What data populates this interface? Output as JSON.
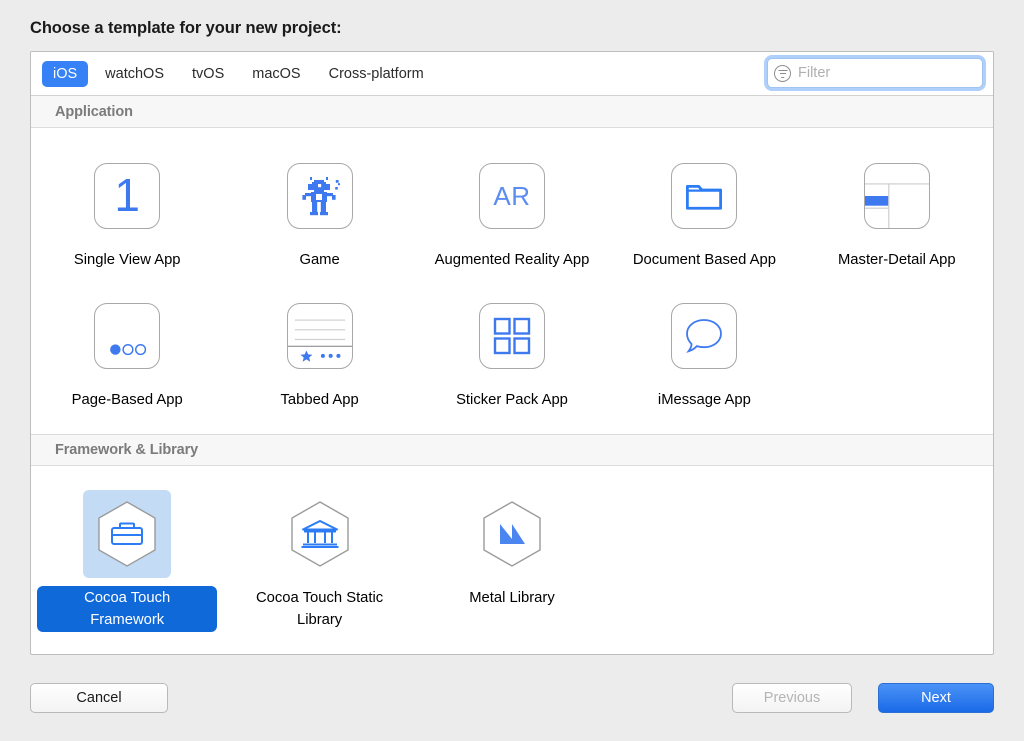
{
  "dialog": {
    "title": "Choose a template for your new project:"
  },
  "tabs": [
    {
      "label": "iOS",
      "selected": true
    },
    {
      "label": "watchOS",
      "selected": false
    },
    {
      "label": "tvOS",
      "selected": false
    },
    {
      "label": "macOS",
      "selected": false
    },
    {
      "label": "Cross-platform",
      "selected": false
    }
  ],
  "filter": {
    "placeholder": "Filter",
    "value": "",
    "icon": "filter-icon",
    "focused": true
  },
  "sections": [
    {
      "header": "Application",
      "templates": [
        {
          "label": "Single View App",
          "icon": "single-view-app-icon",
          "selected": false
        },
        {
          "label": "Game",
          "icon": "game-robot-icon",
          "selected": false
        },
        {
          "label": "Augmented Reality App",
          "icon": "augmented-reality-icon",
          "selected": false
        },
        {
          "label": "Document Based App",
          "icon": "document-folder-icon",
          "selected": false
        },
        {
          "label": "Master-Detail App",
          "icon": "master-detail-icon",
          "selected": false
        },
        {
          "label": "Page-Based App",
          "icon": "page-dots-icon",
          "selected": false
        },
        {
          "label": "Tabbed App",
          "icon": "tabbed-app-icon",
          "selected": false
        },
        {
          "label": "Sticker Pack App",
          "icon": "sticker-grid-icon",
          "selected": false
        },
        {
          "label": "iMessage App",
          "icon": "imessage-bubble-icon",
          "selected": false
        }
      ]
    },
    {
      "header": "Framework & Library",
      "templates": [
        {
          "label": "Cocoa Touch Framework",
          "icon": "briefcase-hex-icon",
          "selected": true
        },
        {
          "label": "Cocoa Touch Static Library",
          "icon": "bank-hex-icon",
          "selected": false
        },
        {
          "label": "Metal Library",
          "icon": "metal-hex-icon",
          "selected": false
        }
      ]
    }
  ],
  "buttons": {
    "cancel": "Cancel",
    "previous": "Previous",
    "next": "Next"
  },
  "colors": {
    "accent_blue": "#3581f5",
    "selection_blue": "#1069d8",
    "selection_backdrop": "#c3dbf5",
    "icon_blue": "#3f79f0",
    "window_bg": "#ececec",
    "panel_bg": "#ffffff",
    "section_header_bg": "#f7f7f7",
    "section_header_text": "#7b7b7b"
  }
}
